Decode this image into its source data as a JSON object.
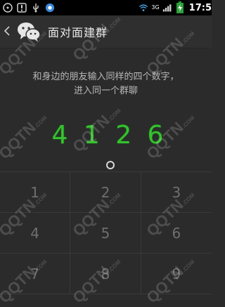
{
  "status_bar": {
    "time": "17:5",
    "network": "3G",
    "icons": [
      "disc-icon",
      "usb-icon",
      "debug-icon",
      "wifi-icon",
      "signal-icon",
      "battery-charging-icon"
    ]
  },
  "header": {
    "title": "面对面建群",
    "back_icon": "chevron-left-icon",
    "logo_icon": "wechat-logo-icon"
  },
  "instructions": {
    "line1": "和身边的朋友输入同样的四个数字，",
    "line2": "进入同一个群聊"
  },
  "code": {
    "digits": [
      "4",
      "1",
      "2",
      "6"
    ],
    "color": "#35c22f"
  },
  "keypad": {
    "keys": [
      "1",
      "2",
      "3",
      "4",
      "5",
      "6",
      "7",
      "8",
      "9"
    ]
  },
  "watermark": {
    "text": "QQTN",
    "suffix": ".COM"
  }
}
